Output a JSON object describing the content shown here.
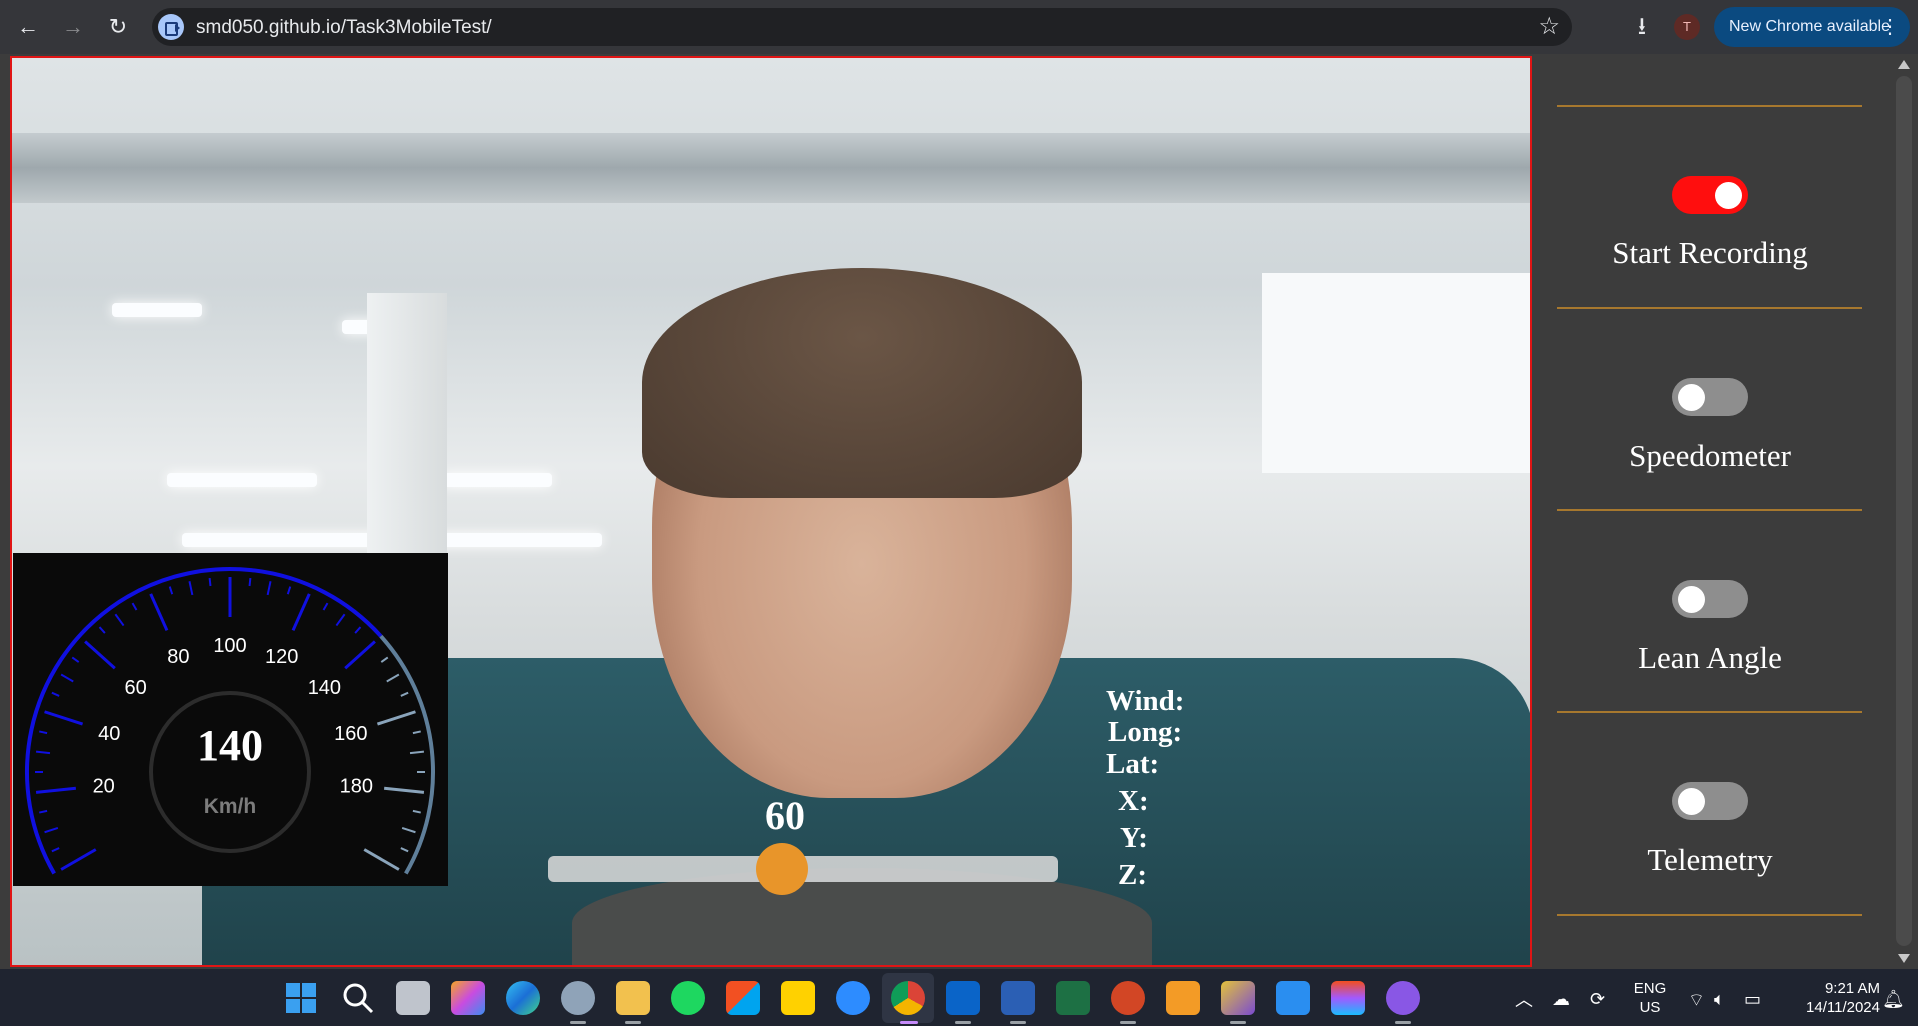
{
  "browser": {
    "url": "smd050.github.io/Task3MobileTest/",
    "profile_initial": "T",
    "update_label": "New Chrome available"
  },
  "speedometer": {
    "value": "140",
    "unit": "Km/h",
    "ticks": [
      "20",
      "40",
      "60",
      "80",
      "100",
      "120",
      "140",
      "160",
      "180"
    ]
  },
  "slider": {
    "value": "60",
    "fraction": 0.4
  },
  "telemetry": {
    "wind": "Wind:",
    "long": "Long:",
    "lat": "Lat:",
    "x": "X:",
    "y": "Y:",
    "z": "Z:"
  },
  "toggles": [
    {
      "label": "Start Recording",
      "on": true
    },
    {
      "label": "Speedometer",
      "on": false
    },
    {
      "label": "Lean Angle",
      "on": false
    },
    {
      "label": "Telemetry",
      "on": false
    }
  ],
  "taskbar": {
    "lang_top": "ENG",
    "lang_bottom": "US",
    "time": "9:21 AM",
    "date": "14/11/2024"
  },
  "colors": {
    "accent_red": "#ff0e0e",
    "divider_gold": "#a7782e",
    "slider_thumb": "#e8952a",
    "gauge_blue": "#1010e0"
  }
}
